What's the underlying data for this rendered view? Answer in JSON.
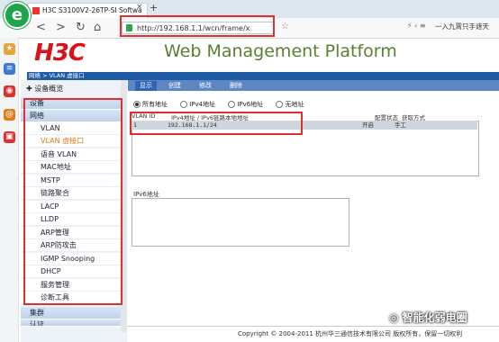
{
  "browser": {
    "tab_title": "H3C S3100V2-26TP-SI Softwa",
    "tab_close": "×",
    "new_tab": "+",
    "nav": {
      "back": "<",
      "forward": ">",
      "reload": "↻",
      "home": "⌂",
      "star": "☆"
    },
    "address": "http://192.168.1.1/wcn/frame/x",
    "addr_tools": "⚡ ‹ ≡",
    "search_text": "一入九霄只手遮天"
  },
  "header": {
    "logo": "H3C",
    "title": "Web Management Platform",
    "breadcrumb": "网络 > VLAN 虚接口"
  },
  "nav": {
    "overview": "设备概览",
    "categories": [
      {
        "label": "设备"
      },
      {
        "label": "网络"
      }
    ],
    "items": [
      {
        "label": "VLAN",
        "active": false
      },
      {
        "label": "VLAN 虚接口",
        "active": true
      },
      {
        "label": "语音 VLAN",
        "active": false
      },
      {
        "label": "MAC地址",
        "active": false
      },
      {
        "label": "MSTP",
        "active": false
      },
      {
        "label": "链路聚合",
        "active": false
      },
      {
        "label": "LACP",
        "active": false
      },
      {
        "label": "LLDP",
        "active": false
      },
      {
        "label": "ARP管理",
        "active": false
      },
      {
        "label": "ARP防攻击",
        "active": false
      },
      {
        "label": "IGMP Snooping",
        "active": false
      },
      {
        "label": "DHCP",
        "active": false
      },
      {
        "label": "服务管理",
        "active": false
      },
      {
        "label": "诊断工具",
        "active": false
      }
    ],
    "bottom": [
      {
        "label": "集群"
      },
      {
        "label": "认证"
      }
    ]
  },
  "toolbar": {
    "tabs": [
      {
        "label": "显示",
        "active": true
      },
      {
        "label": "创建",
        "active": false
      },
      {
        "label": "修改",
        "active": false
      },
      {
        "label": "删除",
        "active": false
      }
    ]
  },
  "filters": {
    "options": [
      {
        "label": "所有地址",
        "checked": true
      },
      {
        "label": "IPv4地址",
        "checked": false
      },
      {
        "label": "IPv6地址",
        "checked": false
      },
      {
        "label": "无地址",
        "checked": false
      }
    ]
  },
  "table": {
    "headers": {
      "vlan": "VLAN ID",
      "ip": "IPv4地址 / IPv6链路本地地址",
      "state": "配置状态",
      "method": "获取方式"
    },
    "rows": [
      {
        "vlan": "1",
        "ip": "192.168.1.1/24",
        "state": "开启",
        "method": "手工"
      }
    ]
  },
  "ipv6": {
    "label": "IPv6地址"
  },
  "footer": {
    "copyright": "Copyright © 2004-2011 杭州华三通信技术有限公司 版权所有，保留一切权利"
  },
  "watermark": {
    "text": "智能化弱电圈"
  },
  "colors": {
    "brand_red": "#d7141a",
    "title_green": "#5a7f2e",
    "nav_blue": "#1f5aa5",
    "highlight": "#e0302e",
    "active_item": "#e07a1b"
  }
}
